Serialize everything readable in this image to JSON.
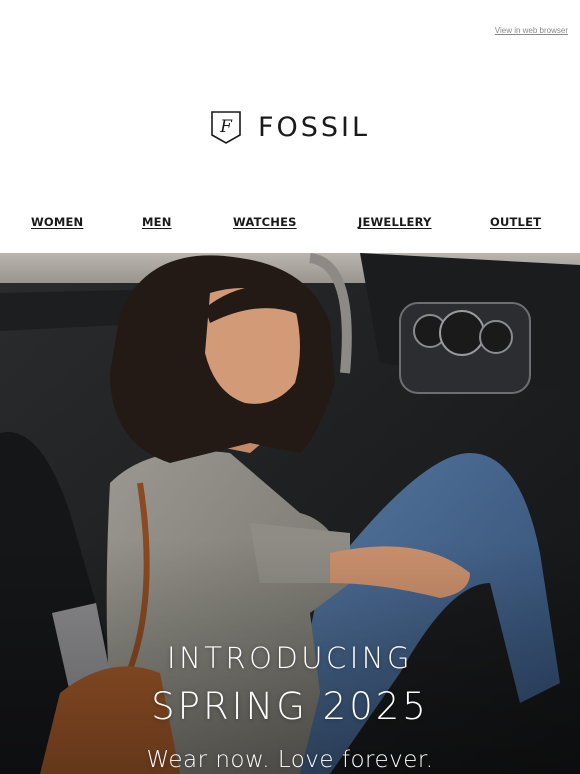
{
  "header": {
    "web_link": "View in web browser"
  },
  "brand": {
    "name": "FOSSIL",
    "mark_letter": "F"
  },
  "nav": {
    "items": [
      {
        "label": "WOMEN"
      },
      {
        "label": "MEN"
      },
      {
        "label": "WATCHES"
      },
      {
        "label": "JEWELLERY"
      },
      {
        "label": "OUTLET"
      }
    ]
  },
  "hero": {
    "line1": "INTRODUCING",
    "line2": "SPRING 2025",
    "line3": "Wear now. Love forever."
  },
  "colors": {
    "text": "#1a1a1a",
    "link_muted": "#8a8a8a",
    "hero_text": "#ffffff"
  }
}
